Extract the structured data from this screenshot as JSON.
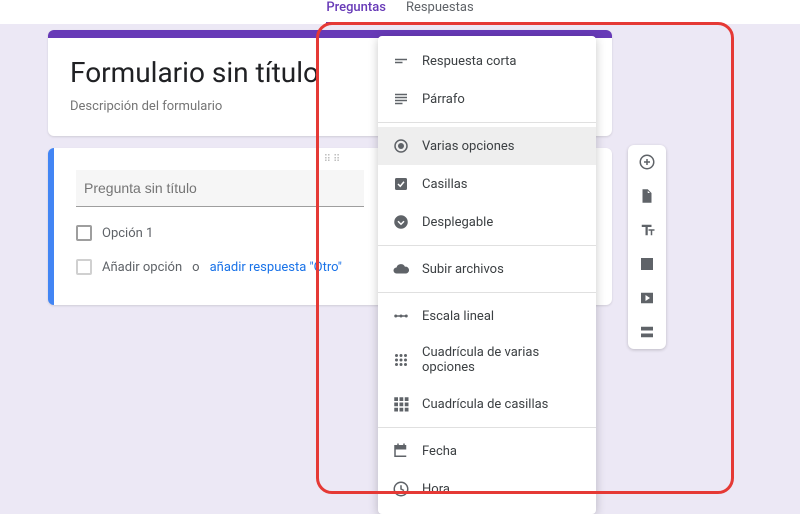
{
  "tabs": {
    "questions": "Preguntas",
    "responses": "Respuestas"
  },
  "header": {
    "title": "Formulario sin título",
    "description": "Descripción del formulario"
  },
  "question": {
    "title_placeholder": "Pregunta sin título",
    "option1": "Opción 1",
    "add_option": "Añadir opción",
    "or": "o",
    "add_other": "añadir respuesta \"Otro\""
  },
  "type_menu": {
    "short_answer": "Respuesta corta",
    "paragraph": "Párrafo",
    "multiple_choice": "Varias opciones",
    "checkboxes": "Casillas",
    "dropdown": "Desplegable",
    "file_upload": "Subir archivos",
    "linear_scale": "Escala lineal",
    "mc_grid": "Cuadrícula de varias opciones",
    "cb_grid": "Cuadrícula de casillas",
    "date": "Fecha",
    "time": "Hora"
  },
  "side_toolbar": {
    "add_question": "Añadir pregunta",
    "import": "Importar preguntas",
    "add_title": "Añadir título y descripción",
    "add_image": "Añadir imagen",
    "add_video": "Añadir vídeo",
    "add_section": "Añadir sección"
  }
}
